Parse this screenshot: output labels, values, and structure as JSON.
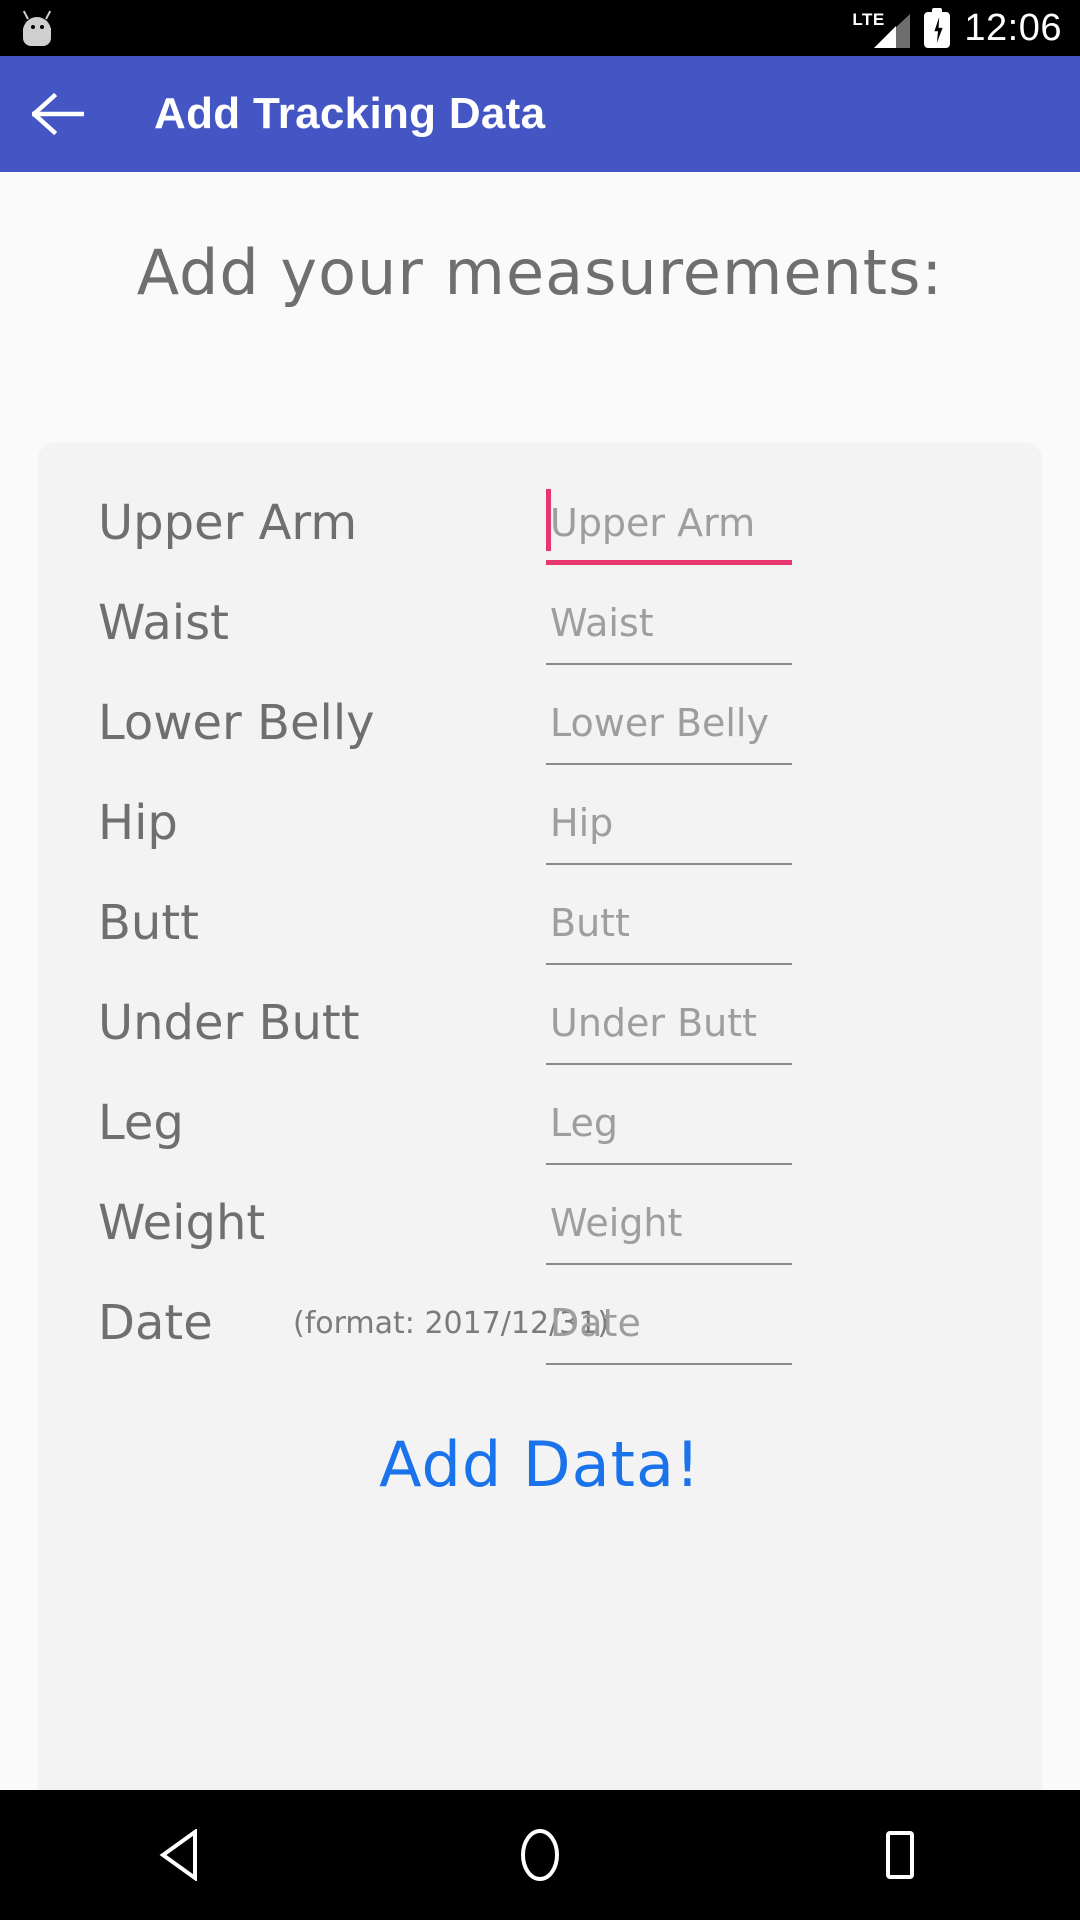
{
  "statusbar": {
    "network_label": "LTE",
    "time": "12:06",
    "icons": [
      "android-robot-icon",
      "lte-signal-icon",
      "battery-charging-icon"
    ]
  },
  "appbar": {
    "title": "Add Tracking Data",
    "back_icon": "arrow-left-icon",
    "background_color": "#4356c4"
  },
  "content": {
    "heading": "Add your measurements:",
    "card_background": "#f3f3f3",
    "accent_focus_color": "#e8366f",
    "submit_color": "#1a73ea"
  },
  "form": {
    "rows": [
      {
        "label": "Upper Arm",
        "placeholder": "Upper Arm",
        "hint": "",
        "focused": true
      },
      {
        "label": "Waist",
        "placeholder": "Waist",
        "hint": "",
        "focused": false
      },
      {
        "label": "Lower Belly",
        "placeholder": "Lower Belly",
        "hint": "",
        "focused": false
      },
      {
        "label": "Hip",
        "placeholder": "Hip",
        "hint": "",
        "focused": false
      },
      {
        "label": "Butt",
        "placeholder": "Butt",
        "hint": "",
        "focused": false
      },
      {
        "label": "Under Butt",
        "placeholder": "Under Butt",
        "hint": "",
        "focused": false
      },
      {
        "label": "Leg",
        "placeholder": "Leg",
        "hint": "",
        "focused": false
      },
      {
        "label": "Weight",
        "placeholder": "Weight",
        "hint": "",
        "focused": false
      },
      {
        "label": "Date",
        "placeholder": "Date",
        "hint": "(format: 2017/12/31)",
        "focused": false
      }
    ],
    "submit_label": "Add Data!"
  },
  "navbar": {
    "back_icon": "triangle-back-icon",
    "home_icon": "circle-home-icon",
    "recents_icon": "square-recents-icon"
  }
}
